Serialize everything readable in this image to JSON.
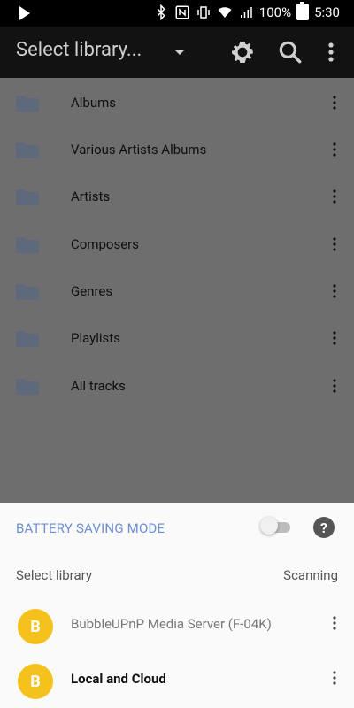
{
  "status_bar": {
    "battery_text": "100%",
    "time": "5:30"
  },
  "appbar": {
    "title": "Select library..."
  },
  "libraries": [
    {
      "label": "Albums"
    },
    {
      "label": "Various Artists Albums"
    },
    {
      "label": "Artists"
    },
    {
      "label": "Composers"
    },
    {
      "label": "Genres"
    },
    {
      "label": "Playlists"
    },
    {
      "label": "All tracks"
    }
  ],
  "sheet": {
    "battery_mode_label": "BATTERY SAVING MODE",
    "help_symbol": "?",
    "select_library_label": "Select library",
    "scanning_label": "Scanning",
    "servers": [
      {
        "name": "BubbleUPnP Media Server (F-04K)",
        "color": "#777777",
        "weight": "normal"
      },
      {
        "name": "Local and Cloud",
        "color": "#111111",
        "weight": "bold"
      }
    ],
    "logo_text": "B"
  },
  "colors": {
    "accent_link": "#6b8fd1",
    "logo": "#f4c11d"
  }
}
